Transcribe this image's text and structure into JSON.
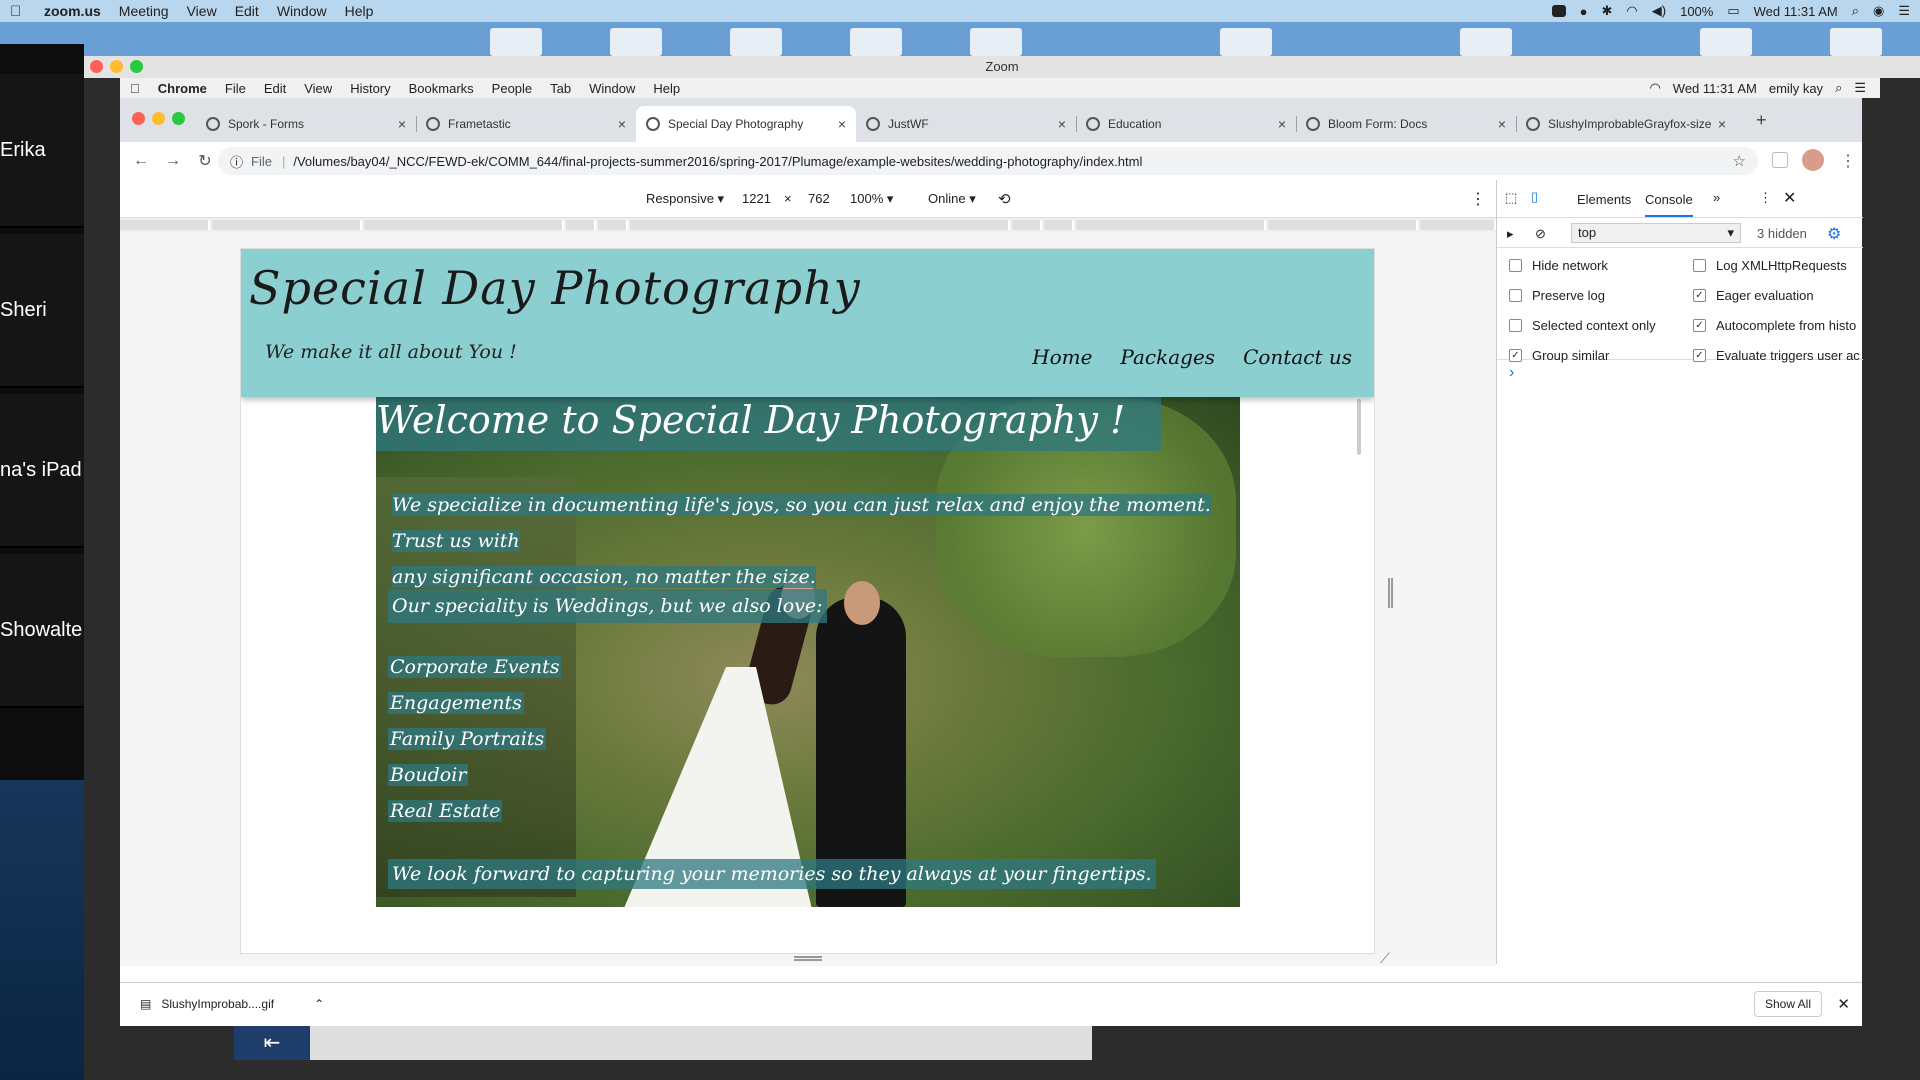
{
  "mac_menubar": {
    "app": "zoom.us",
    "items": [
      "Meeting",
      "View",
      "Edit",
      "Window",
      "Help"
    ],
    "battery": "100%",
    "clock": "Wed 11:31 AM"
  },
  "zoom": {
    "window_title": "Zoom",
    "participants": [
      "Erika",
      "Sheri",
      "na's iPad",
      "Showalte"
    ]
  },
  "chrome_menubar": {
    "app": "Chrome",
    "items": [
      "File",
      "Edit",
      "View",
      "History",
      "Bookmarks",
      "People",
      "Tab",
      "Window",
      "Help"
    ],
    "clock": "Wed 11:31 AM",
    "user": "emily kay"
  },
  "tabs": [
    {
      "label": "Spork - Forms"
    },
    {
      "label": "Frametastic"
    },
    {
      "label": "Special Day Photography"
    },
    {
      "label": "JustWF"
    },
    {
      "label": "Education"
    },
    {
      "label": "Bloom Form: Docs"
    },
    {
      "label": "SlushyImprobableGrayfox-size"
    }
  ],
  "omnibox": {
    "scheme": "File",
    "url": "/Volumes/bay04/_NCC/FEWD-ek/COMM_644/final-projects-summer2016/spring-2017/Plumage/example-websites/wedding-photography/index.html"
  },
  "device_toolbar": {
    "mode": "Responsive",
    "width": "1221",
    "times": "×",
    "height": "762",
    "zoom": "100%",
    "network": "Online"
  },
  "site": {
    "title": "Special Day Photography",
    "tagline": "We make it all about You !",
    "nav": [
      "Home",
      "Packages",
      "Contact us"
    ],
    "welcome": "Welcome to Special Day Photography !",
    "intro_line1": "We specialize in documenting life's joys, so you can just relax and enjoy the moment. Trust us with",
    "intro_line2": "any significant occasion, no matter the size.",
    "love": "Our speciality is Weddings, but we also love:",
    "services": [
      "Corporate Events",
      "Engagements",
      "Family Portraits",
      "Boudoir",
      "Real Estate"
    ],
    "forward": "We look forward to capturing your memories so they always at your fingertips."
  },
  "devtools": {
    "tabs": [
      "Elements",
      "Console"
    ],
    "context": "top",
    "hidden": "3 hidden",
    "options_left": [
      {
        "label": "Hide network",
        "checked": false
      },
      {
        "label": "Preserve log",
        "checked": false
      },
      {
        "label": "Selected context only",
        "checked": false
      },
      {
        "label": "Group similar",
        "checked": true
      }
    ],
    "options_right": [
      {
        "label": "Log XMLHttpRequests",
        "checked": false
      },
      {
        "label": "Eager evaluation",
        "checked": true
      },
      {
        "label": "Autocomplete from histo",
        "checked": true
      },
      {
        "label": "Evaluate triggers user ac",
        "checked": true
      }
    ],
    "prompt": "›"
  },
  "shelf": {
    "file": "SlushyImprobab....gif",
    "show_all": "Show All"
  }
}
